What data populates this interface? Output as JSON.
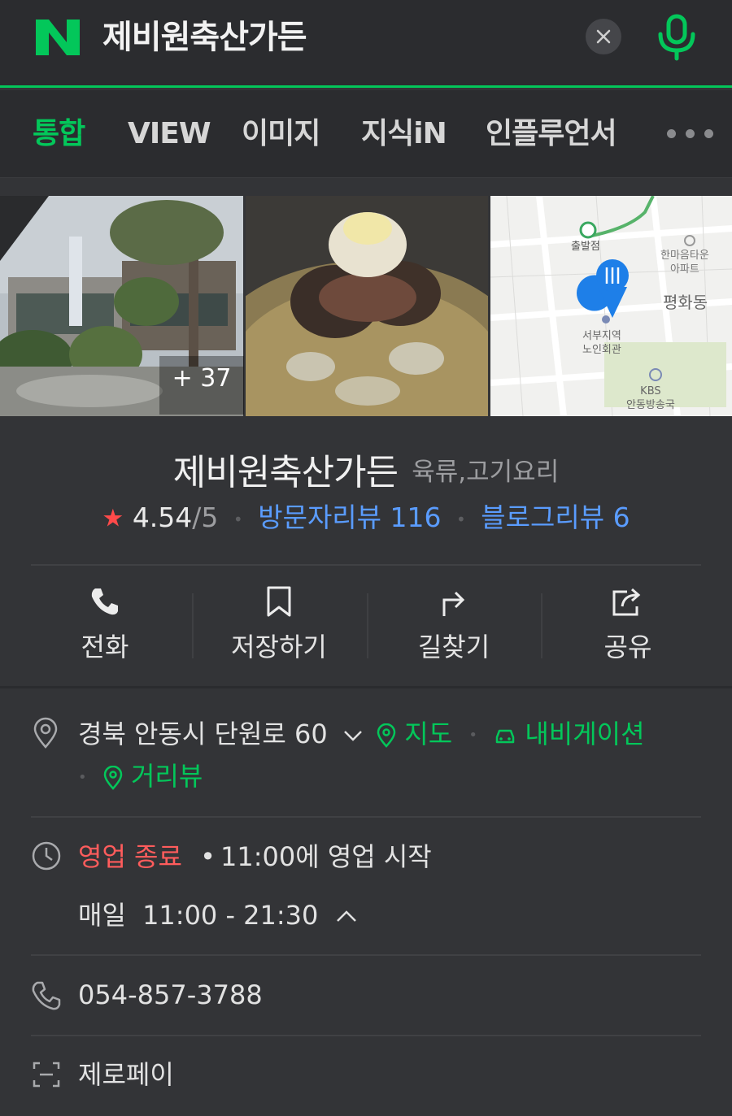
{
  "search": {
    "query": "제비원축산가든",
    "logo": "N",
    "clear_icon": "close-icon",
    "mic_icon": "microphone-icon",
    "brand_color": "#03c75a"
  },
  "tabs": [
    {
      "label": "통합",
      "active": true
    },
    {
      "label": "VIEW",
      "active": false
    },
    {
      "label": "이미지",
      "active": false
    },
    {
      "label": "지식iN",
      "active": false
    },
    {
      "label": "인플루언서",
      "active": false
    }
  ],
  "photos": {
    "more_count": "+ 37",
    "map_labels": {
      "start": "출발점",
      "apartment": "한마음타운\n아파트",
      "district": "평화동",
      "senior_center": "서부지역\n노인회관",
      "broadcaster": "KBS\n안동방송국"
    }
  },
  "place": {
    "name": "제비원축산가든",
    "category": "육류,고기요리",
    "rating": "4.54",
    "rating_max": "/5",
    "visitor_reviews": "방문자리뷰 116",
    "blog_reviews": "블로그리뷰 6",
    "rating_value": 4.54
  },
  "actions": [
    {
      "label": "전화",
      "icon": "phone-icon"
    },
    {
      "label": "저장하기",
      "icon": "bookmark-icon"
    },
    {
      "label": "길찾기",
      "icon": "directions-icon"
    },
    {
      "label": "공유",
      "icon": "share-icon"
    }
  ],
  "address": {
    "text": "경북 안동시 단원로 60",
    "map_link": "지도",
    "navi_link": "내비게이션",
    "street_view": "거리뷰"
  },
  "hours": {
    "status": "영업 종료",
    "next_open": "11:00에 영업 시작",
    "daily_label": "매일",
    "daily_hours": "11:00 - 21:30"
  },
  "phone": "054-857-3788",
  "zeropay": "제로페이",
  "colors": {
    "accent_green": "#03c75a",
    "link_blue": "#5a9cff",
    "closed_red": "#ff5c5c",
    "star_red": "#ff4a4a"
  }
}
